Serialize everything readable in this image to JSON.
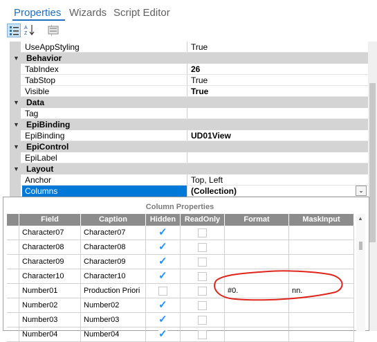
{
  "tabs": [
    "Properties",
    "Wizards",
    "Script Editor"
  ],
  "toolbar": {
    "buttons": [
      "categorized-icon",
      "alphabetical-icon",
      "property-pages-icon"
    ]
  },
  "properties": [
    {
      "kind": "prop",
      "name": "UseAppStyling",
      "value": "True",
      "bold": false
    },
    {
      "kind": "cat",
      "name": "Behavior"
    },
    {
      "kind": "prop",
      "name": "TabIndex",
      "value": "26",
      "bold": true
    },
    {
      "kind": "prop",
      "name": "TabStop",
      "value": "True",
      "bold": false
    },
    {
      "kind": "prop",
      "name": "Visible",
      "value": "True",
      "bold": true
    },
    {
      "kind": "cat",
      "name": "Data"
    },
    {
      "kind": "prop",
      "name": "Tag",
      "value": "",
      "bold": false
    },
    {
      "kind": "cat",
      "name": "EpiBinding"
    },
    {
      "kind": "prop",
      "name": "EpiBinding",
      "value": "UD01View",
      "bold": true
    },
    {
      "kind": "cat",
      "name": "EpiControl"
    },
    {
      "kind": "prop",
      "name": "EpiLabel",
      "value": "",
      "bold": false
    },
    {
      "kind": "cat",
      "name": "Layout"
    },
    {
      "kind": "prop",
      "name": "Anchor",
      "value": "Top, Left",
      "bold": false
    },
    {
      "kind": "prop",
      "name": "Columns",
      "value": "(Collection)",
      "bold": true,
      "selected": true
    }
  ],
  "popup": {
    "title": "Column Properties",
    "columns": [
      "Field",
      "Caption",
      "Hidden",
      "ReadOnly",
      "Format",
      "MaskInput"
    ],
    "rows": [
      {
        "field": "Character07",
        "caption": "Character07",
        "hidden": true,
        "readonly": false,
        "format": "",
        "mask": ""
      },
      {
        "field": "Character08",
        "caption": "Character08",
        "hidden": true,
        "readonly": false,
        "format": "",
        "mask": ""
      },
      {
        "field": "Character09",
        "caption": "Character09",
        "hidden": true,
        "readonly": false,
        "format": "",
        "mask": ""
      },
      {
        "field": "Character10",
        "caption": "Character10",
        "hidden": true,
        "readonly": false,
        "format": "",
        "mask": ""
      },
      {
        "field": "Number01",
        "caption": "Production Priori",
        "hidden": false,
        "readonly": false,
        "format": "#0.",
        "mask": "nn."
      },
      {
        "field": "Number02",
        "caption": "Number02",
        "hidden": true,
        "readonly": false,
        "format": "",
        "mask": ""
      },
      {
        "field": "Number03",
        "caption": "Number03",
        "hidden": true,
        "readonly": false,
        "format": "",
        "mask": ""
      },
      {
        "field": "Number04",
        "caption": "Number04",
        "hidden": true,
        "readonly": false,
        "format": "",
        "mask": ""
      }
    ]
  },
  "colors": {
    "accent": "#1f6fc0",
    "selection": "#0078d7",
    "category": "#d4d4d4",
    "header": "#8c8c8c",
    "check": "#1e90ff",
    "annotation": "#e0241b"
  }
}
